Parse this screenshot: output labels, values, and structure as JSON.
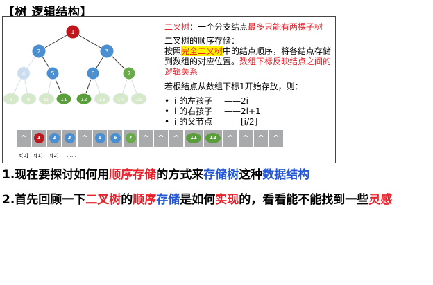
{
  "heading": "【树 逻辑结构】",
  "tree": {
    "nodes": [
      {
        "label": "1",
        "level": 0,
        "color": "#c0161b"
      },
      {
        "label": "2",
        "level": 1,
        "color": "#4a8fd1"
      },
      {
        "label": "3",
        "level": 1,
        "color": "#4a8fd1"
      },
      {
        "label": "4",
        "level": 2,
        "color": "#c9dcf0",
        "faded": true
      },
      {
        "label": "5",
        "level": 2,
        "color": "#4a8fd1"
      },
      {
        "label": "6",
        "level": 2,
        "color": "#4a8fd1"
      },
      {
        "label": "7",
        "level": 2,
        "color": "#6aaa4a"
      },
      {
        "label": "8",
        "level": 3,
        "color": "#d5e8c8",
        "faded": true
      },
      {
        "label": "9",
        "level": 3,
        "color": "#d5e8c8",
        "faded": true
      },
      {
        "label": "10",
        "level": 3,
        "color": "#d5e8c8",
        "faded": true
      },
      {
        "label": "11",
        "level": 3,
        "color": "#5a9e3c"
      },
      {
        "label": "12",
        "level": 3,
        "color": "#5a9e3c"
      },
      {
        "label": "13",
        "level": 3,
        "color": "#d5e8c8",
        "faded": true
      },
      {
        "label": "14",
        "level": 3,
        "color": "#d5e8c8",
        "faded": true
      },
      {
        "label": "15",
        "level": 3,
        "color": "#d5e8c8",
        "faded": true
      }
    ]
  },
  "desc": {
    "title_a": "二叉树",
    "title_b": "：一个分支结点",
    "title_c": "最多只能有两棵子树",
    "storage_title": "二叉树的顺序存储：",
    "p1_a": "按照",
    "p1_hl": "完全二叉树",
    "p1_b": "中的结点顺序，将各结点存储到数组的对应位置。",
    "p1_red": "数组下标反映结点之间的逻辑关系",
    "p2": "若根结点从数组下标1开始存放，则：",
    "bullets": [
      {
        "k": "i 的左孩子",
        "v": "——2i"
      },
      {
        "k": "i 的右孩子",
        "v": "——2i+1"
      },
      {
        "k": "i 的父节点",
        "v": "——⌊i/2⌋"
      }
    ],
    "bullet_mark": "•"
  },
  "array": {
    "caret": "^",
    "cells": [
      {
        "label": null
      },
      {
        "label": "1",
        "color": "#c0161b"
      },
      {
        "label": "2",
        "color": "#4a8fd1"
      },
      {
        "label": "3",
        "color": "#4a8fd1"
      },
      {
        "label": null
      },
      {
        "label": "5",
        "color": "#4a8fd1"
      },
      {
        "label": "6",
        "color": "#4a8fd1"
      },
      {
        "label": "7",
        "color": "#6aaa4a"
      },
      {
        "label": null
      },
      {
        "label": null
      },
      {
        "label": null
      },
      {
        "label": "11",
        "color": "#5a9e3c",
        "wide": true
      },
      {
        "label": "12",
        "color": "#5a9e3c",
        "wide": true
      },
      {
        "label": null
      },
      {
        "label": null
      },
      {
        "label": null
      },
      {
        "label": null
      }
    ],
    "indices": [
      "t[0]",
      "t[1]",
      "t[2]",
      "……"
    ]
  },
  "line1": {
    "a": "1.现在要探讨如何用",
    "b": "顺序存储",
    "c": "的方式来",
    "d": "存储树",
    "e": "这种",
    "f": "数据结构"
  },
  "line2": {
    "a": "2.首先回顾一下",
    "b": "二叉树",
    "c": "的",
    "d": "顺序",
    "e": "存储",
    "f": "是如何",
    "g": "实现",
    "h": "的，看看能不能找到一些",
    "i": "灵感"
  }
}
